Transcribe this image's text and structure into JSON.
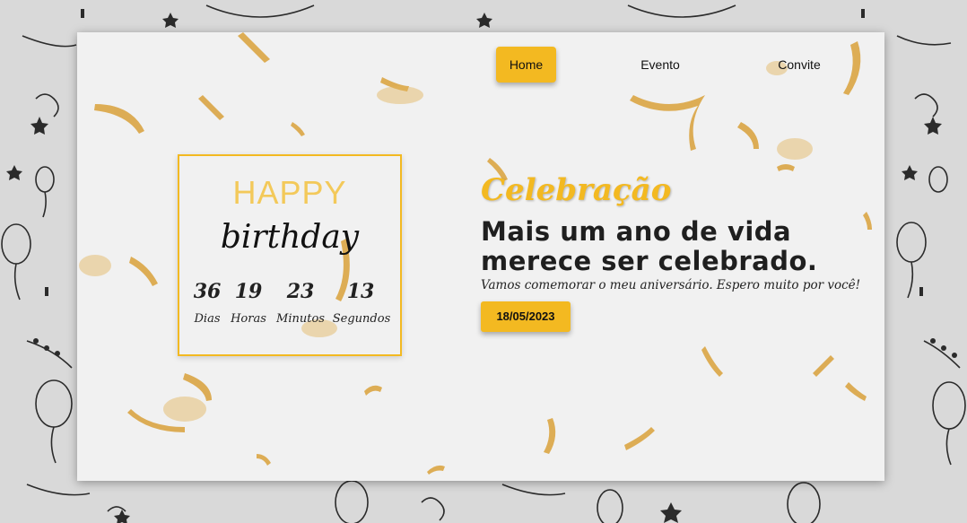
{
  "nav": {
    "items": [
      {
        "label": "Home",
        "active": true
      },
      {
        "label": "Evento",
        "active": false
      },
      {
        "label": "Convite",
        "active": false
      }
    ]
  },
  "countdown": {
    "title_top": "HAPPY",
    "title_bottom": "birthday",
    "units": [
      {
        "value": "36",
        "label": "Dias"
      },
      {
        "value": "19",
        "label": "Horas"
      },
      {
        "value": "23",
        "label": "Minutos"
      },
      {
        "value": "13",
        "label": "Segundos"
      }
    ]
  },
  "hero": {
    "kicker": "Celebração",
    "headline": "Mais um ano de vida merece ser celebrado.",
    "subtext": "Vamos comemorar o meu aniversário. Espero muito por você!",
    "date_button": "18/05/2023"
  },
  "colors": {
    "accent": "#f3b921",
    "card_bg": "#f1f1f1",
    "page_bg": "#d9d9d9"
  }
}
